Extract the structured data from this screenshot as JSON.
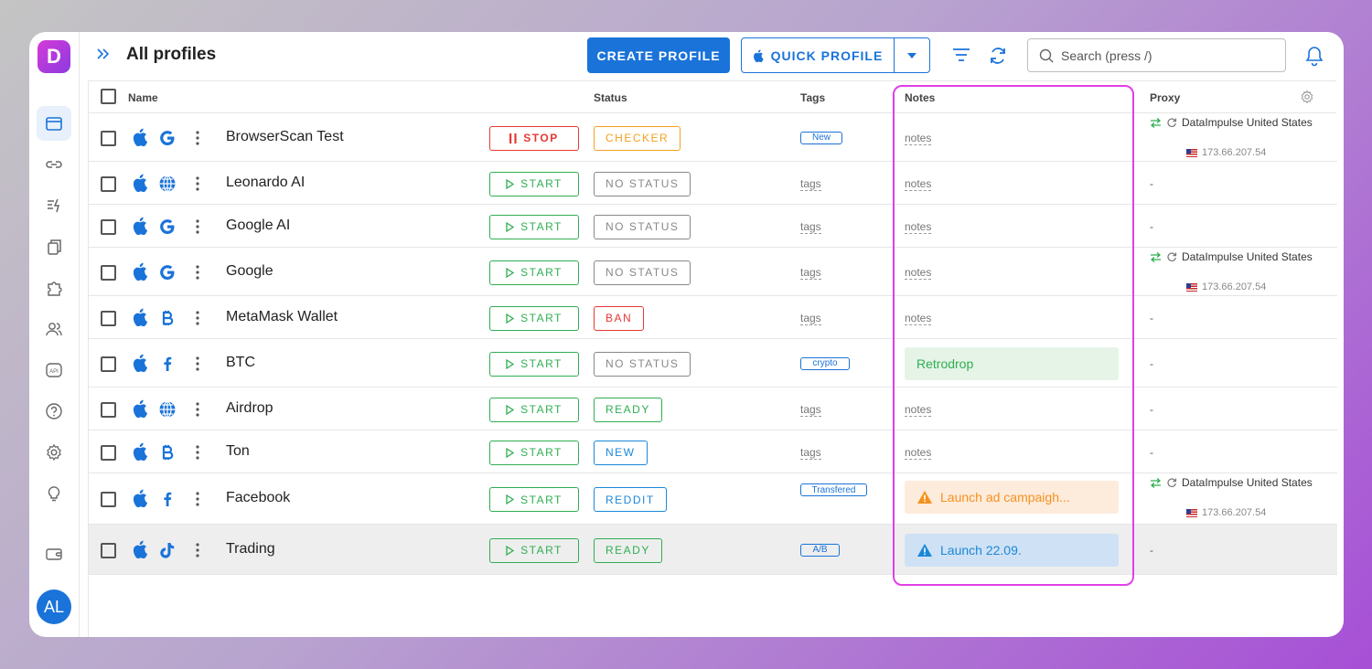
{
  "brand": {
    "logo_letter": "D"
  },
  "user": {
    "initials": "AL"
  },
  "header": {
    "title": "All profiles",
    "create_label": "CREATE PROFILE",
    "quick_label": "QUICK PROFILE",
    "search_placeholder": "Search (press /)"
  },
  "columns": {
    "name": "Name",
    "status": "Status",
    "tags": "Tags",
    "notes": "Notes",
    "proxy": "Proxy"
  },
  "rows": [
    {
      "name": "BrowserScan Test",
      "icon": "google-icon",
      "action": "STOP",
      "status": "CHECKER",
      "status_color": "#f5a020",
      "tag": "New",
      "tag_link": "",
      "note": "notes",
      "note_box": "",
      "proxy": "DataImpulse United States",
      "ip": "173.66.207.54"
    },
    {
      "name": "Leonardo AI",
      "icon": "globe-icon",
      "action": "START",
      "status": "NO STATUS",
      "status_color": "#888888",
      "tag": "",
      "tag_link": "tags",
      "note": "notes",
      "note_box": "",
      "proxy": "-",
      "ip": ""
    },
    {
      "name": "Google AI",
      "icon": "google-icon",
      "action": "START",
      "status": "NO STATUS",
      "status_color": "#888888",
      "tag": "",
      "tag_link": "tags",
      "note": "notes",
      "note_box": "",
      "proxy": "-",
      "ip": ""
    },
    {
      "name": "Google",
      "icon": "google-icon",
      "action": "START",
      "status": "NO STATUS",
      "status_color": "#888888",
      "tag": "",
      "tag_link": "tags",
      "note": "notes",
      "note_box": "",
      "proxy": "DataImpulse United States",
      "ip": "173.66.207.54"
    },
    {
      "name": "MetaMask Wallet",
      "icon": "bitcoin-icon",
      "action": "START",
      "status": "BAN",
      "status_color": "#e53935",
      "tag": "",
      "tag_link": "tags",
      "note": "notes",
      "note_box": "",
      "proxy": "-",
      "ip": ""
    },
    {
      "name": "BTC",
      "icon": "facebook-icon",
      "action": "START",
      "status": "NO STATUS",
      "status_color": "#888888",
      "tag": "crypto",
      "tag_link": "",
      "note": "",
      "note_box": "Retrodrop",
      "proxy": "-",
      "ip": ""
    },
    {
      "name": "Airdrop",
      "icon": "globe-icon",
      "action": "START",
      "status": "READY",
      "status_color": "#2fae52",
      "tag": "",
      "tag_link": "tags",
      "note": "notes",
      "note_box": "",
      "proxy": "-",
      "ip": ""
    },
    {
      "name": "Ton",
      "icon": "bitcoin-icon",
      "action": "START",
      "status": "NEW",
      "status_color": "#1a88d9",
      "tag": "",
      "tag_link": "tags",
      "note": "notes",
      "note_box": "",
      "proxy": "-",
      "ip": ""
    },
    {
      "name": "Facebook",
      "icon": "facebook-icon",
      "action": "START",
      "status": "REDDIT",
      "status_color": "#1a88d9",
      "tag": "Transfered",
      "tag_link": "",
      "note": "",
      "note_box": "Launch ad campaigh...",
      "proxy": "DataImpulse United States",
      "ip": "173.66.207.54"
    },
    {
      "name": "Trading",
      "icon": "tiktok-icon",
      "action": "START",
      "status": "READY",
      "status_color": "#2fae52",
      "tag": "A/B",
      "tag_link": "",
      "note": "",
      "note_box": "Launch 22.09.",
      "proxy": "-",
      "ip": ""
    }
  ],
  "colors": {
    "accent": "#1a73d9",
    "highlight": "#e040e8",
    "start_green": "#2fae52",
    "stop_red": "#e53935"
  }
}
